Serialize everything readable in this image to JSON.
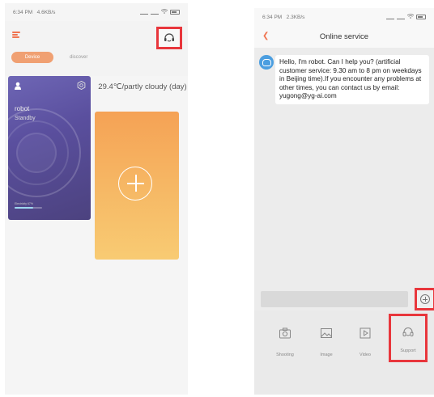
{
  "left_screen": {
    "status_bar": {
      "time": "6:34 PM",
      "speed": "4.6KB/s"
    },
    "tabs": [
      {
        "label": "Device",
        "active": true
      },
      {
        "label": "discover",
        "active": false
      }
    ],
    "robot_card": {
      "name": "robot",
      "status": "Standby",
      "battery_label": "Electricity 67%",
      "battery_level": 0.67
    },
    "weather": "29.4℃/partly cloudy (day)",
    "colors": {
      "accent": "#f07552",
      "highlight": "#e8363c",
      "card_purple": "#5a4f9e",
      "card_orange": "#f6b764"
    }
  },
  "right_screen": {
    "status_bar": {
      "time": "6:34 PM",
      "speed": "2.3KB/s"
    },
    "title": "Online service",
    "message": "Hello, I'm robot. Can I help you? (artificial customer service: 9.30 am to 8 pm on weekdays in Beijing time).If you encounter any problems at other times, you can contact us by email: yugong@yg-ai.com",
    "input_placeholder": "",
    "tray": [
      {
        "label": "Shooting",
        "icon": "camera-icon"
      },
      {
        "label": "Image",
        "icon": "image-icon"
      },
      {
        "label": "Video",
        "icon": "video-icon"
      },
      {
        "label": "Support",
        "icon": "headset-icon"
      }
    ]
  }
}
